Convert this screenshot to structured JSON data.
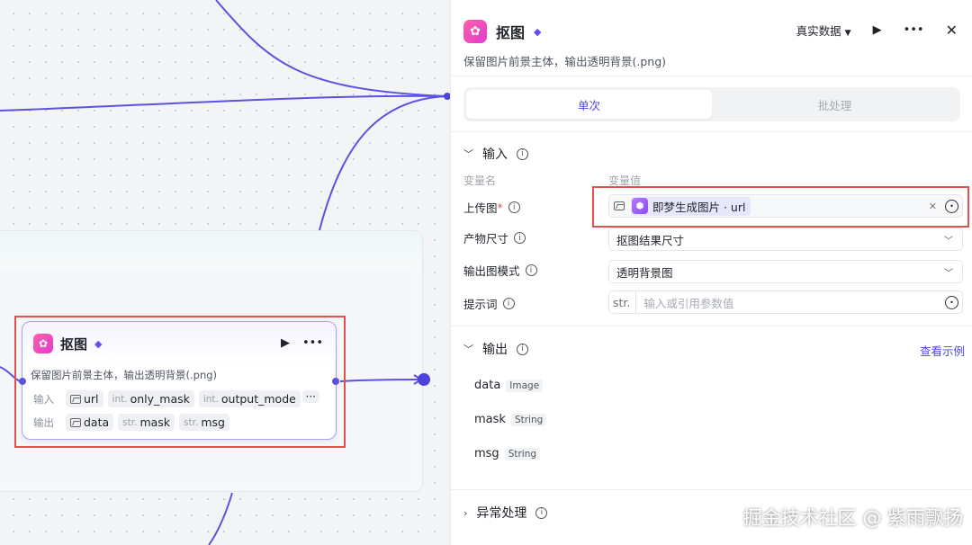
{
  "node": {
    "title": "抠图",
    "description": "保留图片前景主体，输出透明背景(.png)",
    "input_label": "输入",
    "output_label": "输出",
    "inputs": [
      {
        "type": "",
        "name": "url",
        "icon": "image-icon"
      },
      {
        "type": "int.",
        "name": "only_mask"
      },
      {
        "type": "int.",
        "name": "output_mode"
      }
    ],
    "outputs": [
      {
        "type": "",
        "name": "data",
        "icon": "image-icon"
      },
      {
        "type": "str.",
        "name": "mask"
      },
      {
        "type": "str.",
        "name": "msg"
      }
    ],
    "more": "···"
  },
  "panel": {
    "title": "抠图",
    "description": "保留图片前景主体，输出透明背景(.png)",
    "data_mode": "真实数据",
    "tabs": [
      "单次",
      "批处理"
    ],
    "input_section": "输入",
    "col_var_name": "变量名",
    "col_var_value": "变量值",
    "params": [
      {
        "label": "上传图",
        "required": "*",
        "value": "即梦生成图片 · url"
      },
      {
        "label": "产物尺寸",
        "value": "抠图结果尺寸"
      },
      {
        "label": "输出图模式",
        "value": "透明背景图"
      },
      {
        "label": "提示词",
        "type_tag": "str.",
        "placeholder": "输入或引用参数值"
      }
    ],
    "output_section": "输出",
    "view_example": "查看示例",
    "outputs": [
      {
        "name": "data",
        "type": "Image"
      },
      {
        "name": "mask",
        "type": "String"
      },
      {
        "name": "msg",
        "type": "String"
      }
    ],
    "exception_section": "异常处理"
  },
  "watermark": "掘金技术社区 @ 紫雨飘扬",
  "colors": {
    "accent": "#4d44dc",
    "highlight": "#e45050",
    "node_border": "#a8a4ee"
  }
}
